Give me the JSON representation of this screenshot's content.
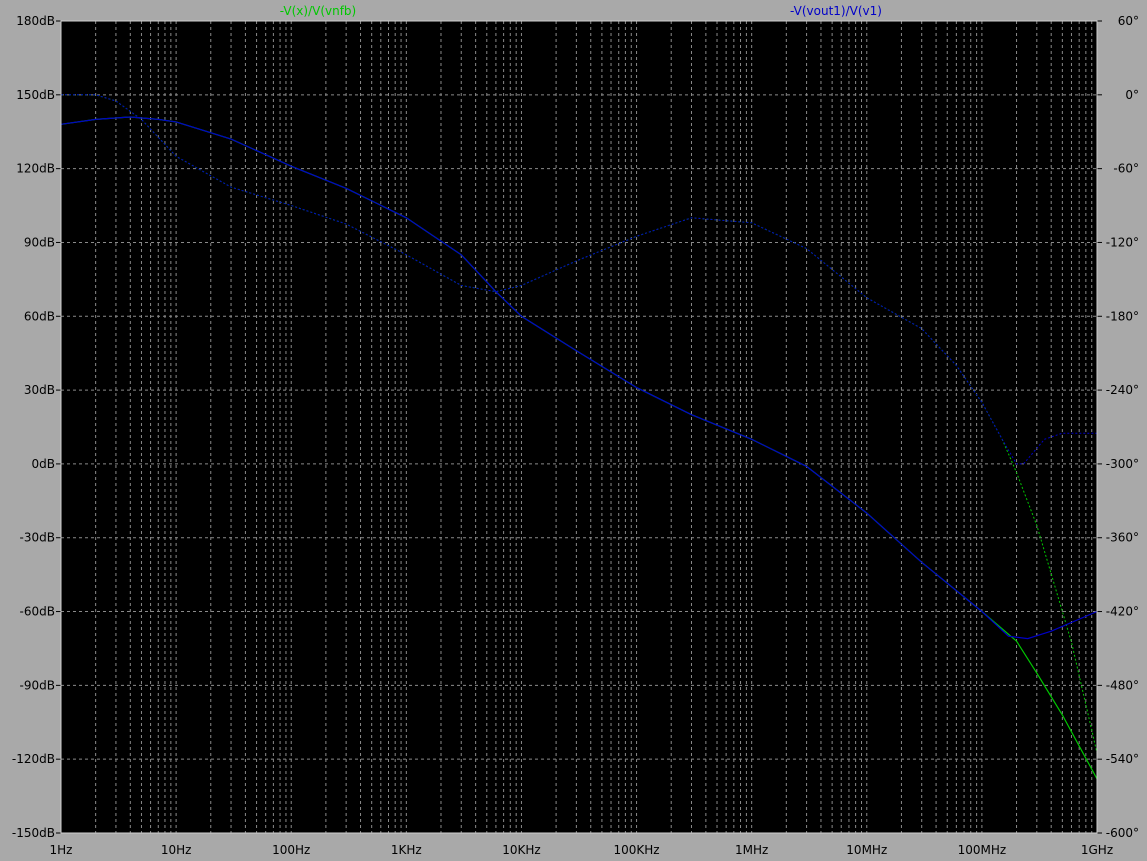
{
  "window": {
    "background": "#a9a9a9",
    "plot_background": "#000000",
    "grid_color": "#8a8a8a"
  },
  "chart_data": {
    "type": "line",
    "title": "",
    "x_scale": "log",
    "x_range_hz": [
      1,
      1000000000
    ],
    "x_ticks": [
      {
        "value": 1,
        "label": "1Hz"
      },
      {
        "value": 10,
        "label": "10Hz"
      },
      {
        "value": 100,
        "label": "100Hz"
      },
      {
        "value": 1000,
        "label": "1KHz"
      },
      {
        "value": 10000,
        "label": "10KHz"
      },
      {
        "value": 100000,
        "label": "100KHz"
      },
      {
        "value": 1000000,
        "label": "1MHz"
      },
      {
        "value": 10000000,
        "label": "10MHz"
      },
      {
        "value": 100000000,
        "label": "100MHz"
      },
      {
        "value": 1000000000,
        "label": "1GHz"
      }
    ],
    "y_left": {
      "unit": "dB",
      "range": [
        -150,
        180
      ],
      "ticks": [
        {
          "value": 180,
          "label": "180dB"
        },
        {
          "value": 150,
          "label": "150dB"
        },
        {
          "value": 120,
          "label": "120dB"
        },
        {
          "value": 90,
          "label": "90dB"
        },
        {
          "value": 60,
          "label": "60dB"
        },
        {
          "value": 30,
          "label": "30dB"
        },
        {
          "value": 0,
          "label": "0dB"
        },
        {
          "value": -30,
          "label": "-30dB"
        },
        {
          "value": -60,
          "label": "-60dB"
        },
        {
          "value": -90,
          "label": "-90dB"
        },
        {
          "value": -120,
          "label": "-120dB"
        },
        {
          "value": -150,
          "label": "-150dB"
        }
      ]
    },
    "y_right": {
      "unit": "deg",
      "range": [
        -600,
        60
      ],
      "ticks": [
        {
          "value": 60,
          "label": "60°"
        },
        {
          "value": 0,
          "label": "0°"
        },
        {
          "value": -60,
          "label": "-60°"
        },
        {
          "value": -120,
          "label": "-120°"
        },
        {
          "value": -180,
          "label": "-180°"
        },
        {
          "value": -240,
          "label": "-240°"
        },
        {
          "value": -300,
          "label": "-300°"
        },
        {
          "value": -360,
          "label": "-360°"
        },
        {
          "value": -420,
          "label": "-420°"
        },
        {
          "value": -480,
          "label": "-480°"
        },
        {
          "value": -540,
          "label": "-540°"
        },
        {
          "value": -600,
          "label": "-600°"
        }
      ]
    },
    "grid": true,
    "series": [
      {
        "name": "-V(x)/V(vnfb)",
        "color": "#00c800",
        "magnitude_db": [
          [
            1,
            138
          ],
          [
            2,
            140
          ],
          [
            4,
            141
          ],
          [
            7,
            140
          ],
          [
            10,
            139
          ],
          [
            30,
            132
          ],
          [
            100,
            121
          ],
          [
            300,
            112
          ],
          [
            1000,
            100
          ],
          [
            3000,
            85
          ],
          [
            6000,
            70
          ],
          [
            10000,
            60
          ],
          [
            30000,
            46
          ],
          [
            100000,
            31
          ],
          [
            300000,
            20
          ],
          [
            1000000,
            10
          ],
          [
            3000000,
            -1
          ],
          [
            10000000,
            -20
          ],
          [
            30000000,
            -40
          ],
          [
            100000000,
            -60
          ],
          [
            200000000,
            -72
          ],
          [
            300000000,
            -85
          ],
          [
            500000000,
            -102
          ],
          [
            1000000000,
            -128
          ]
        ],
        "phase_deg": [
          [
            1,
            0
          ],
          [
            2,
            0
          ],
          [
            3,
            -5
          ],
          [
            5,
            -20
          ],
          [
            10,
            -50
          ],
          [
            30,
            -75
          ],
          [
            100,
            -90
          ],
          [
            300,
            -105
          ],
          [
            1000,
            -130
          ],
          [
            3000,
            -155
          ],
          [
            6000,
            -160
          ],
          [
            10000,
            -155
          ],
          [
            30000,
            -135
          ],
          [
            100000,
            -115
          ],
          [
            300000,
            -100
          ],
          [
            1000000,
            -104
          ],
          [
            3000000,
            -125
          ],
          [
            10000000,
            -165
          ],
          [
            30000000,
            -190
          ],
          [
            60000000,
            -220
          ],
          [
            100000000,
            -250
          ],
          [
            150000000,
            -280
          ],
          [
            200000000,
            -307
          ],
          [
            300000000,
            -350
          ],
          [
            600000000,
            -445
          ],
          [
            1000000000,
            -535
          ]
        ]
      },
      {
        "name": "-V(vout1)/V(v1)",
        "color": "#0000c8",
        "magnitude_db": [
          [
            1,
            138
          ],
          [
            2,
            140
          ],
          [
            4,
            141
          ],
          [
            7,
            140
          ],
          [
            10,
            139
          ],
          [
            30,
            132
          ],
          [
            100,
            121
          ],
          [
            300,
            112
          ],
          [
            1000,
            100
          ],
          [
            3000,
            85
          ],
          [
            6000,
            70
          ],
          [
            10000,
            60
          ],
          [
            30000,
            46
          ],
          [
            100000,
            31
          ],
          [
            300000,
            20
          ],
          [
            1000000,
            10
          ],
          [
            3000000,
            -1
          ],
          [
            10000000,
            -20
          ],
          [
            30000000,
            -40
          ],
          [
            100000000,
            -60
          ],
          [
            170000000,
            -70
          ],
          [
            250000000,
            -71
          ],
          [
            400000000,
            -68
          ],
          [
            1000000000,
            -60
          ]
        ],
        "phase_deg": [
          [
            1,
            0
          ],
          [
            2,
            0
          ],
          [
            3,
            -5
          ],
          [
            5,
            -20
          ],
          [
            10,
            -50
          ],
          [
            30,
            -75
          ],
          [
            100,
            -90
          ],
          [
            300,
            -105
          ],
          [
            1000,
            -130
          ],
          [
            3000,
            -155
          ],
          [
            6000,
            -160
          ],
          [
            10000,
            -155
          ],
          [
            30000,
            -135
          ],
          [
            100000,
            -115
          ],
          [
            300000,
            -100
          ],
          [
            1000000,
            -104
          ],
          [
            3000000,
            -125
          ],
          [
            10000000,
            -165
          ],
          [
            30000000,
            -190
          ],
          [
            60000000,
            -220
          ],
          [
            100000000,
            -250
          ],
          [
            150000000,
            -280
          ],
          [
            200000000,
            -300
          ],
          [
            230000000,
            -300
          ],
          [
            350000000,
            -280
          ],
          [
            500000000,
            -275
          ],
          [
            1000000000,
            -275
          ]
        ]
      }
    ]
  }
}
